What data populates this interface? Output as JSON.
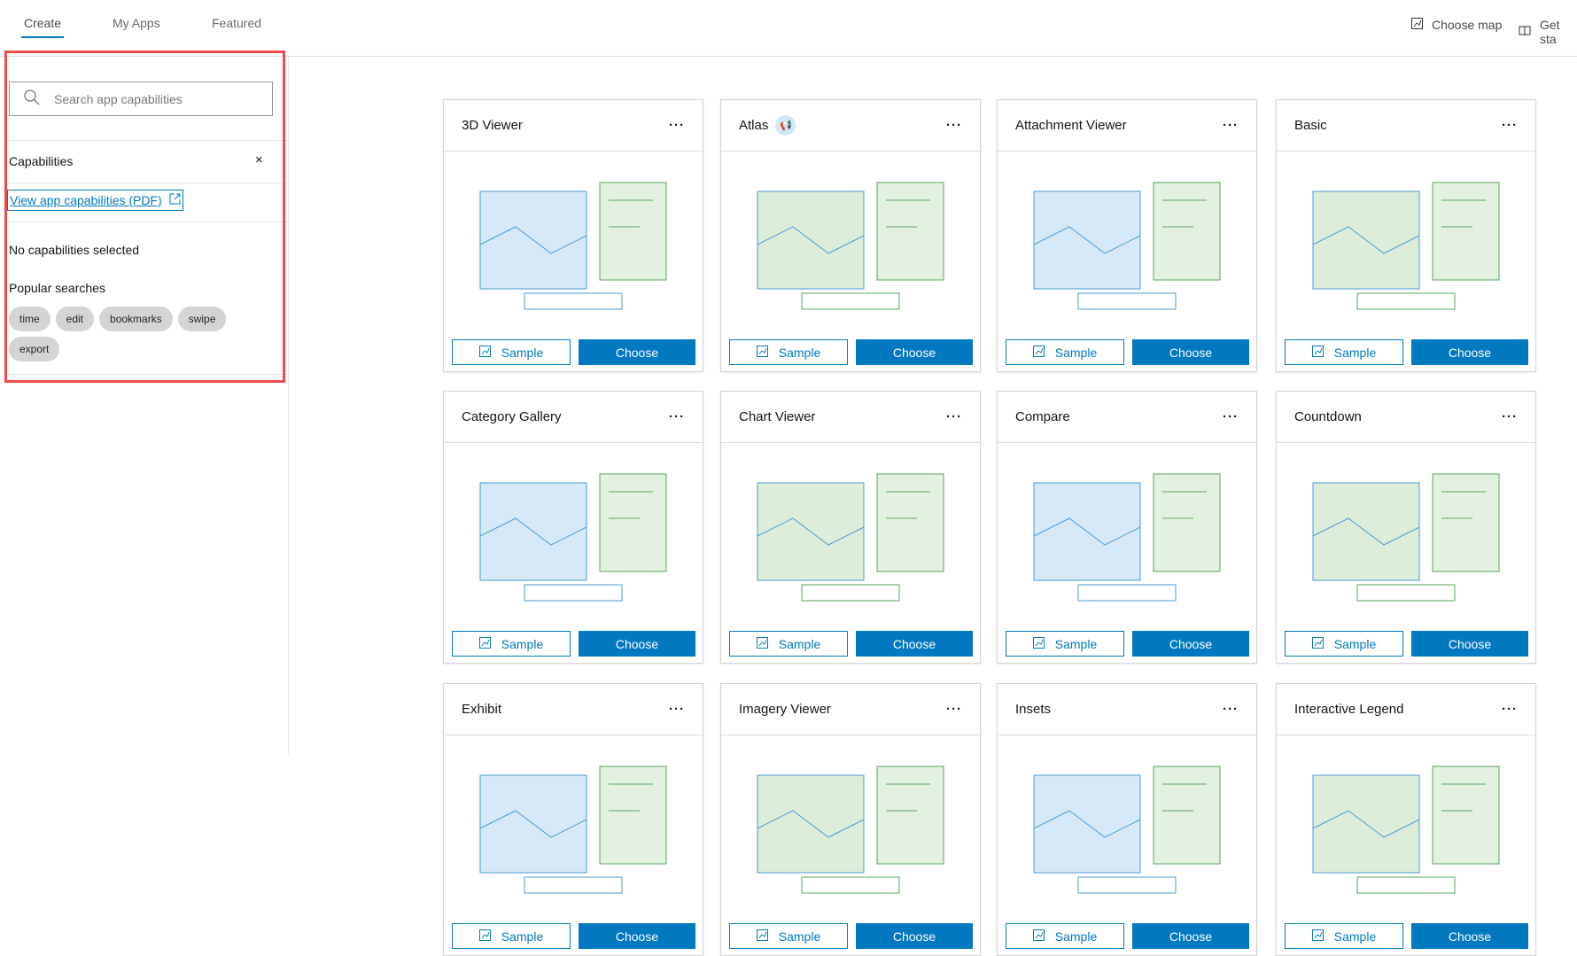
{
  "tabs": [
    {
      "label": "Create"
    },
    {
      "label": "My Apps"
    },
    {
      "label": "Featured"
    }
  ],
  "top_links": {
    "choose_map": "Choose map",
    "get_started": "Get sta"
  },
  "sidebar": {
    "search_placeholder": "Search app capabilities",
    "capabilities_title": "Capabilities",
    "pdf_link": "View app capabilities (PDF)",
    "none_selected": "No capabilities selected",
    "popular_title": "Popular searches",
    "chips": [
      "time",
      "edit",
      "bookmarks",
      "swipe",
      "export"
    ]
  },
  "card_buttons": {
    "sample": "Sample",
    "choose": "Choose"
  },
  "cards": [
    {
      "title": "3D Viewer"
    },
    {
      "title": "Atlas",
      "badge": "megaphone-icon"
    },
    {
      "title": "Attachment Viewer"
    },
    {
      "title": "Basic"
    },
    {
      "title": "Category Gallery"
    },
    {
      "title": "Chart Viewer"
    },
    {
      "title": "Compare"
    },
    {
      "title": "Countdown"
    },
    {
      "title": "Exhibit"
    },
    {
      "title": "Imagery Viewer"
    },
    {
      "title": "Insets"
    },
    {
      "title": "Interactive Legend"
    }
  ],
  "colors": {
    "accent": "#0079c1",
    "highlight": "#f04a4a",
    "illus_blue": "#4a9bd6",
    "illus_green": "#5aa55a"
  }
}
